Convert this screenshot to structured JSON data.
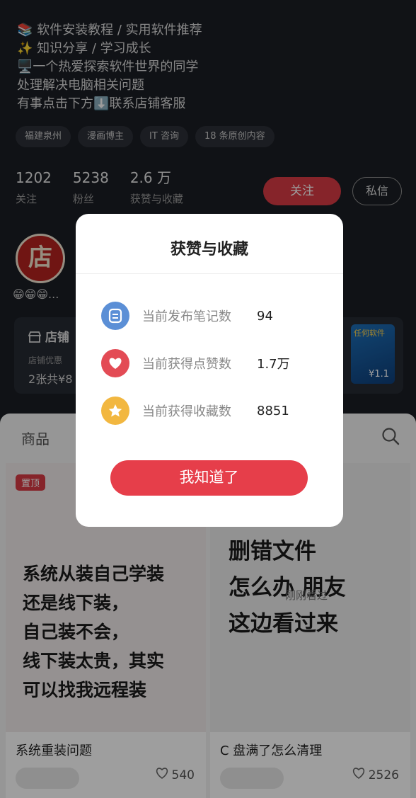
{
  "profile": {
    "bio": [
      "📚 软件安装教程 / 实用软件推荐",
      "✨ 知识分享 / 学习成长",
      "🖥️一个热爱探索软件世界的同学",
      "处理解决电脑相关问题",
      "有事点击下方⬇️联系店铺客服"
    ],
    "tags": [
      "福建泉州",
      "漫画博主",
      "IT 咨询",
      "18 条原创内容"
    ],
    "stats": [
      {
        "num": "1202",
        "label": "关注"
      },
      {
        "num": "5238",
        "label": "粉丝"
      },
      {
        "num": "2.6 万",
        "label": "获赞与收藏"
      }
    ],
    "follow_label": "关注",
    "message_label": "私信",
    "avatar_char": "店",
    "emoji_row": "😁😁😁...",
    "store": {
      "title": "店铺",
      "sub": "店铺优惠",
      "coupon": "2张共¥8",
      "thumb_price": "¥1.1",
      "thumb_text": "任何软件"
    }
  },
  "goods": {
    "tab_label": "商品",
    "cards": [
      {
        "pin": "置顶",
        "cover_lines": [
          "系统从装自己学装",
          "还是线下装，",
          "自己装不会，",
          "线下装太贵，其实",
          "可以找我远程装"
        ],
        "title": "系统重装问题",
        "likes": "540"
      },
      {
        "cover_lines": [
          "删错文件",
          "怎么办   朋友",
          "这边看过来"
        ],
        "hint": "刚刚看过",
        "title": "C 盘满了怎么清理",
        "likes": "2526"
      }
    ]
  },
  "modal": {
    "title": "获赞与收藏",
    "rows": [
      {
        "label": "当前发布笔记数",
        "value": "94",
        "icon": "note-icon",
        "color": "#5b8fd6"
      },
      {
        "label": "当前获得点赞数",
        "value": "1.7万",
        "icon": "heart-icon",
        "color": "#e34b55"
      },
      {
        "label": "当前获得收藏数",
        "value": "8851",
        "icon": "star-icon",
        "color": "#f2b740"
      }
    ],
    "ok_label": "我知道了"
  }
}
